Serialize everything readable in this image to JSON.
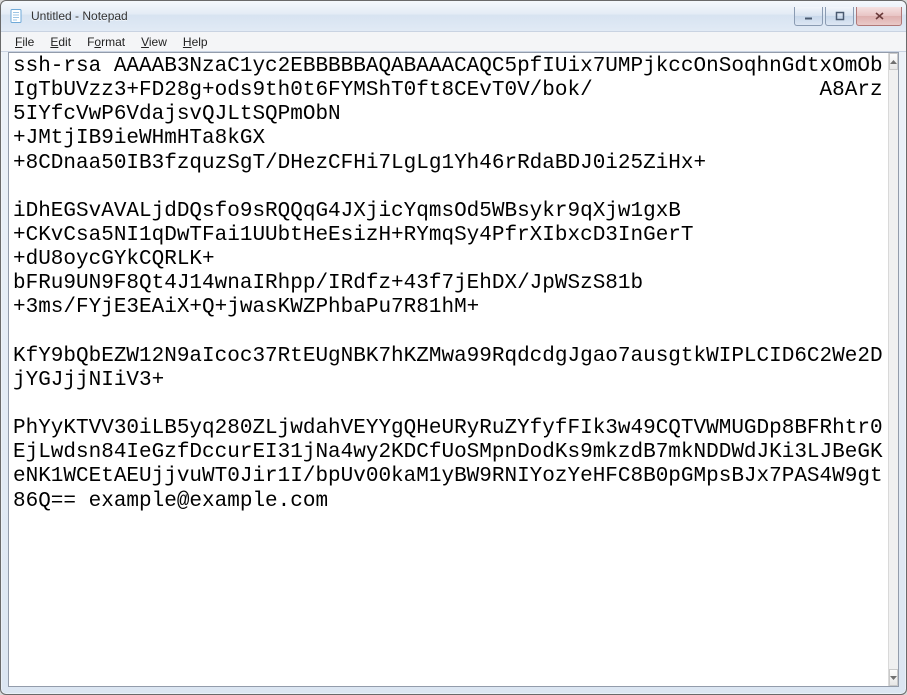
{
  "window": {
    "title": "Untitled - Notepad"
  },
  "menubar": {
    "items": [
      {
        "text": "File",
        "accel": "F"
      },
      {
        "text": "Edit",
        "accel": "E"
      },
      {
        "text": "Format",
        "accel": "o"
      },
      {
        "text": "View",
        "accel": "V"
      },
      {
        "text": "Help",
        "accel": "H"
      }
    ]
  },
  "editor": {
    "content": "ssh-rsa AAAAB3NzaC1yc2EBBBBBAQABAAACAQC5pfIUix7UMPjkccOnSoqhnGdtxOmObIgTbUVzz3+FD28g+ods9th0t6FYMShT0ft8CEvT0V/bok/                  A8Arz5IYfcVwP6VdajsvQJLtSQPmObN\n+JMtjIB9ieWHmHTa8kGX\n+8CDnaa50IB3fzquzSgT/DHezCFHi7LgLg1Yh46rRdaBDJ0i25ZiHx+\n\niDhEGSvAVALjdDQsfo9sRQQqG4JXjicYqmsOd5WBsykr9qXjw1gxB\n+CKvCsa5NI1qDwTFai1UUbtHeEsizH+RYmqSy4PfrXIbxcD3InGerT\n+dU8oycGYkCQRLK+\nbFRu9UN9F8Qt4J14wnaIRhpp/IRdfz+43f7jEhDX/JpWSzS81b\n+3ms/FYjE3EAiX+Q+jwasKWZPhbaPu7R81hM+\n\nKfY9bQbEZW12N9aIcoc37RtEUgNBK7hKZMwa99RqdcdgJgao7ausgtkWIPLCID6C2We2DjYGJjjNIiV3+\n\nPhYyKTVV30iLB5yq280ZLjwdahVEYYgQHeURyRuZYfyfFIk3w49CQTVWMUGDp8BFRhtr0EjLwdsn84IeGzfDccurEI31jNa4wy2KDCfUoSMpnDodKs9mkzdB7mkNDDWdJKi3LJBeGKeNK1WCEtAEUjjvuWT0Jir1I/bpUv00kaM1yBW9RNIYozYeHFC8B0pGMpsBJx7PAS4W9gt86Q== example@example.com"
  }
}
